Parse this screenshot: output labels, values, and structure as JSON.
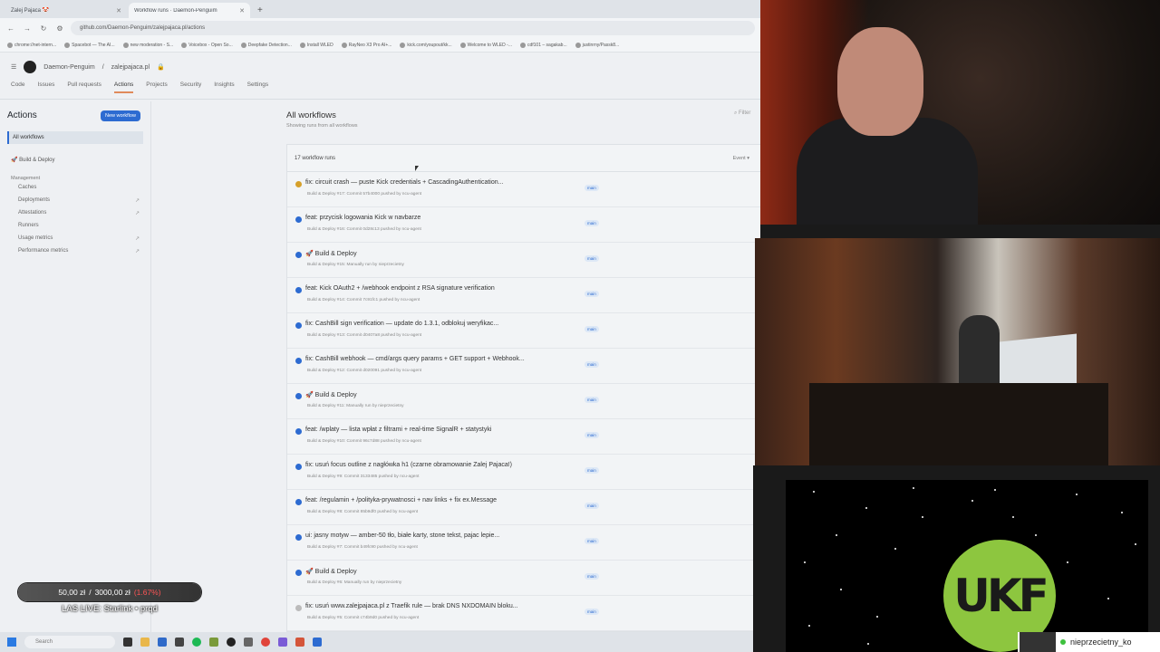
{
  "browser": {
    "tabs": [
      {
        "title": "Zalej Pajaca 🤡",
        "active": false
      },
      {
        "title": "Workflow runs · Daemon-Penguim",
        "active": true
      }
    ],
    "url": "github.com/Daemon-Penguim/zalejpajaca.pl/actions",
    "bookmarks": [
      "chrome://net-intern...",
      "Spacebot — The AI...",
      "new moderation - S...",
      "Voicebox - Open So...",
      "Deepfake Detection...",
      "Install WLED",
      "RayNeo X3 Pro AI+...",
      "kick.com/youpout/kk...",
      "Welcome to WLED -...",
      "cdf101 – sagakab...",
      "justinrny/Passk8..."
    ]
  },
  "github": {
    "owner": "Daemon-Penguim",
    "repo": "zalejpajaca.pl",
    "repo_tabs": [
      "Code",
      "Issues",
      "Pull requests",
      "Actions",
      "Projects",
      "Security",
      "Insights",
      "Settings"
    ],
    "active_tab": "Actions"
  },
  "sidebar": {
    "title": "Actions",
    "new_workflow": "New workflow",
    "all_workflows": "All workflows",
    "workflow": "Build & Deploy",
    "management_label": "Management",
    "management": [
      "Caches",
      "Deployments",
      "Attestations",
      "Runners",
      "Usage metrics",
      "Performance metrics"
    ]
  },
  "main": {
    "title": "All workflows",
    "subtitle": "Showing runs from all workflows",
    "filter_placeholder": "Filter",
    "runs_count": "17 workflow runs",
    "event_filter": "Event ▾",
    "runs": [
      {
        "title": "fix: circuit crash — puste Kick credentials + CascadingAuthentication...",
        "meta": "Build & Deploy #17: Commit 57b4000 pushed by ncu-agent",
        "branch": "main",
        "status": "prog"
      },
      {
        "title": "feat: przycisk logowania Kick w navbarze",
        "meta": "Build & Deploy #16: Commit 0d28c13 pushed by ncu-agent",
        "branch": "main",
        "status": "ok"
      },
      {
        "title": "🚀 Build & Deploy",
        "meta": "Build & Deploy #15: Manually run by nieprzecietny",
        "branch": "main",
        "status": "ok"
      },
      {
        "title": "feat: Kick OAuth2 + /webhook endpoint z RSA signature verification",
        "meta": "Build & Deploy #14: Commit 7c91fc1 pushed by ncu-agent",
        "branch": "main",
        "status": "ok"
      },
      {
        "title": "fix: CashBill sign verification — update do 1.3.1, odblokuj weryfikac...",
        "meta": "Build & Deploy #13: Commit d0407a8 pushed by ncu-agent",
        "branch": "main",
        "status": "ok"
      },
      {
        "title": "fix: CashBill webhook — cmd/args query params + GET support + Webhook...",
        "meta": "Build & Deploy #12: Commit d020091 pushed by ncu-agent",
        "branch": "main",
        "status": "ok"
      },
      {
        "title": "🚀 Build & Deploy",
        "meta": "Build & Deploy #11: Manually run by nieprzecietny",
        "branch": "main",
        "status": "ok"
      },
      {
        "title": "feat: /wplaty — lista wpłat z filtrami + real-time SignalR + statystyki",
        "meta": "Build & Deploy #10: Commit 96c7d88 pushed by ncu-agent",
        "branch": "main",
        "status": "ok"
      },
      {
        "title": "fix: usuń focus outline z nagłówka h1 (czarne obramowanie Zalej Pajaca!)",
        "meta": "Build & Deploy #9: Commit 3133485 pushed by ncu-agent",
        "branch": "main",
        "status": "ok"
      },
      {
        "title": "feat: /regulamin + /polityka-prywatnosci + nav links + fix ex.Message",
        "meta": "Build & Deploy #8: Commit 85b9df0 pushed by ncu-agent",
        "branch": "main",
        "status": "ok"
      },
      {
        "title": "ui: jasny motyw — amber-50 tło, białe karty, stone tekst, pajac lepie...",
        "meta": "Build & Deploy #7: Commit b49fc90 pushed by ncu-agent",
        "branch": "main",
        "status": "ok"
      },
      {
        "title": "🚀 Build & Deploy",
        "meta": "Build & Deploy #6: Manually run by nieprzecietny",
        "branch": "main",
        "status": "ok"
      },
      {
        "title": "fix: usuń www.zalejpajaca.pl z Traefik rule — brak DNS NXDOMAIN bloku...",
        "meta": "Build & Deploy #5: Commit c74b9d0 pushed by ncu-agent",
        "branch": "main",
        "status": "cancel"
      }
    ]
  },
  "taskbar": {
    "search": "Search"
  },
  "overlay": {
    "goal_current": "50,00 zł",
    "goal_sep": "/",
    "goal_target": "3000,00 zł",
    "goal_pct": "(1.67%)",
    "now_playing": "LAS LIVE: Starlink • prqd",
    "chatter_name": "nieprzecietny_ko",
    "logo_text": "UKF"
  },
  "colors": {
    "accent": "#2d6bd1",
    "ukf_green": "#8dc63f",
    "goal_pct": "#ff5555"
  }
}
